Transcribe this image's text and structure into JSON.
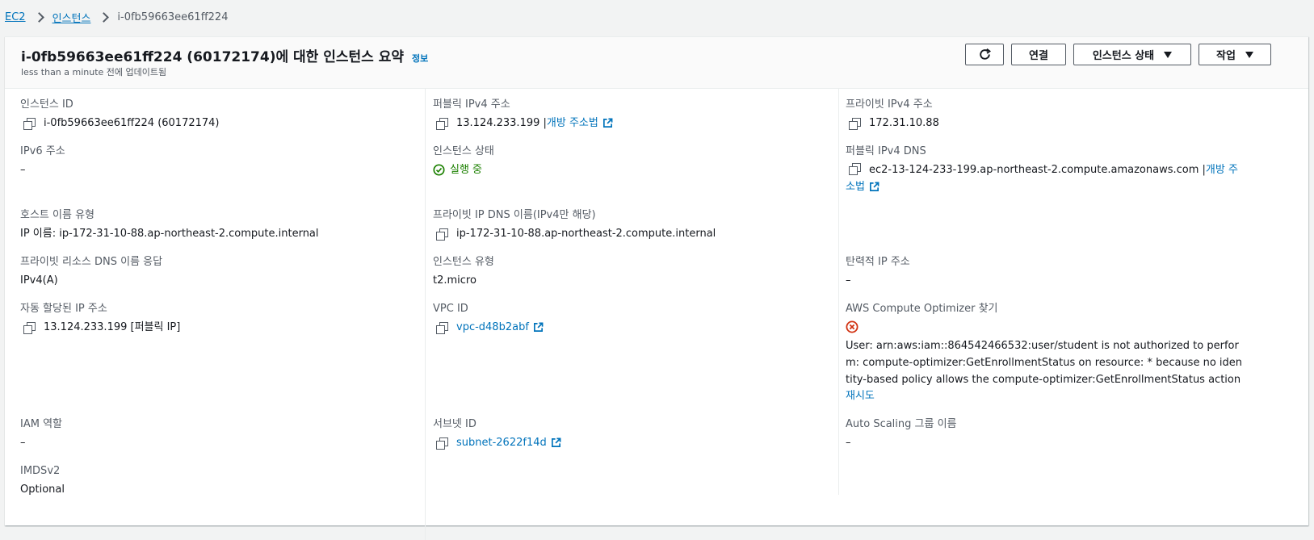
{
  "breadcrumb": {
    "items": [
      "EC2",
      "인스턴스"
    ],
    "current": "i-0fb59663ee61ff224"
  },
  "header": {
    "title": "i-0fb59663ee61ff224 (60172174)에 대한 인스턴스 요약",
    "info": "정보",
    "subtitle": "less than a minute 전에 업데이트됨",
    "buttons": {
      "connect": "연결",
      "instance_state": "인스턴스 상태",
      "actions": "작업"
    }
  },
  "fields": {
    "instance_id": {
      "label": "인스턴스 ID",
      "value": "i-0fb59663ee61ff224 (60172174)"
    },
    "public_ipv4": {
      "label": "퍼블릭 IPv4 주소",
      "value": "13.124.233.199 |",
      "link": "개방 주소법"
    },
    "private_ipv4": {
      "label": "프라이빗 IPv4 주소",
      "value": "172.31.10.88"
    },
    "ipv6": {
      "label": "IPv6 주소",
      "value": "–"
    },
    "instance_state": {
      "label": "인스턴스 상태",
      "value": "실행 중"
    },
    "public_dns": {
      "label": "퍼블릭 IPv4 DNS",
      "value": "ec2-13-124-233-199.ap-northeast-2.compute.amazonaws.com |",
      "link": "개방 주소법"
    },
    "hostname_type": {
      "label": "호스트 이름 유형",
      "value": "IP 이름: ip-172-31-10-88.ap-northeast-2.compute.internal"
    },
    "private_dns": {
      "label": "프라이빗 IP DNS 이름(IPv4만 해당)",
      "value": "ip-172-31-10-88.ap-northeast-2.compute.internal"
    },
    "private_resource_dns": {
      "label": "프라이빗 리소스 DNS 이름 응답",
      "value": "IPv4(A)"
    },
    "instance_type": {
      "label": "인스턴스 유형",
      "value": "t2.micro"
    },
    "elastic_ip": {
      "label": "탄력적 IP 주소",
      "value": "–"
    },
    "auto_ip": {
      "label": "자동 할당된 IP 주소",
      "value": "13.124.233.199 [퍼블릭 IP]"
    },
    "vpc_id": {
      "label": "VPC ID",
      "value": "vpc-d48b2abf"
    },
    "compute_optimizer": {
      "label": "AWS Compute Optimizer 찾기",
      "error": "User: arn:aws:iam::864542466532:user/student is not authorized to perform: compute-optimizer:GetEnrollmentStatus on resource: * because no identity-based policy allows the compute-optimizer:GetEnrollmentStatus action",
      "retry": "재시도"
    },
    "iam_role": {
      "label": "IAM 역할",
      "value": "–"
    },
    "subnet_id": {
      "label": "서브넷 ID",
      "value": "subnet-2622f14d"
    },
    "auto_scaling": {
      "label": "Auto Scaling 그룹 이름",
      "value": "–"
    },
    "imdsv2": {
      "label": "IMDSv2",
      "value": "Optional"
    }
  },
  "colors": {
    "link": "#0073bb",
    "success": "#1d8102",
    "error": "#d13212",
    "text": "#16191f",
    "label": "#545b64"
  },
  "icons": [
    "chevron-right-icon",
    "refresh-icon",
    "caret-down-icon",
    "copy-icon",
    "external-link-icon",
    "check-circle-icon",
    "error-circle-icon"
  ]
}
